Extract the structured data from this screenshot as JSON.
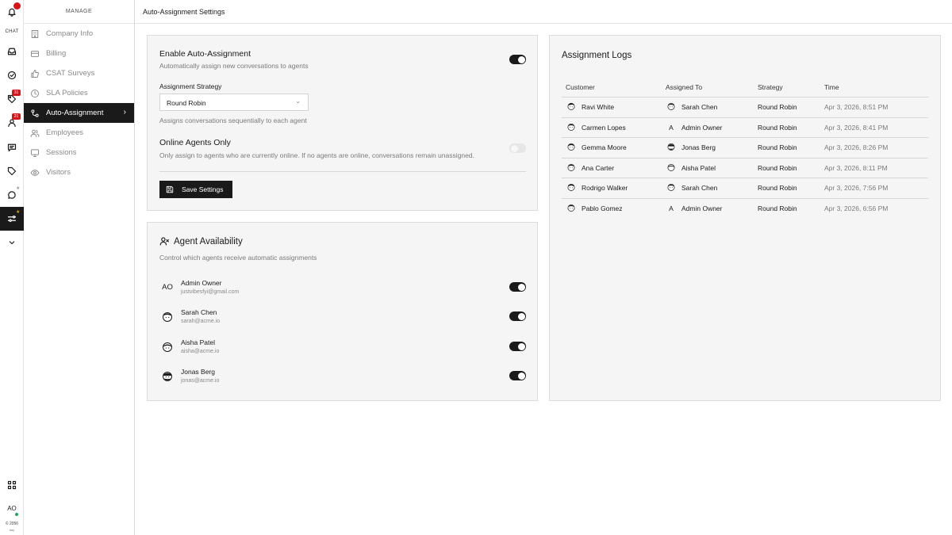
{
  "rail": {
    "chat_label": "CHAT",
    "badge_assigned": "31",
    "badge_contacts": "21",
    "user_initials": "AO",
    "copyright": "© 2056",
    "copyright_sub": "day"
  },
  "menu": {
    "title": "MANAGE",
    "items": [
      {
        "label": "Company Info",
        "icon": "building-icon"
      },
      {
        "label": "Billing",
        "icon": "credit-card-icon"
      },
      {
        "label": "CSAT Surveys",
        "icon": "thumbs-up-icon"
      },
      {
        "label": "SLA Policies",
        "icon": "clock-icon"
      },
      {
        "label": "Auto-Assignment",
        "icon": "route-icon",
        "active": true
      },
      {
        "label": "Employees",
        "icon": "users-icon"
      },
      {
        "label": "Sessions",
        "icon": "monitor-icon"
      },
      {
        "label": "Visitors",
        "icon": "eye-icon"
      }
    ]
  },
  "header": {
    "title": "Auto-Assignment Settings"
  },
  "settings": {
    "enable_title": "Enable Auto-Assignment",
    "enable_desc": "Automatically assign new conversations to agents",
    "enable_on": true,
    "strategy_label": "Assignment Strategy",
    "strategy_value": "Round Robin",
    "strategy_help": "Assigns conversations sequentially to each agent",
    "online_title": "Online Agents Only",
    "online_desc": "Only assign to agents who are currently online. If no agents are online, conversations remain unassigned.",
    "online_on": false,
    "save_label": "Save Settings"
  },
  "agents": {
    "title": "Agent Availability",
    "subtitle": "Control which agents receive automatic assignments",
    "list": [
      {
        "initials": "AO",
        "name": "Admin Owner",
        "email": "justvibesfyi@gmail.com",
        "enabled": true
      },
      {
        "name": "Sarah Chen",
        "email": "sarah@acme.io",
        "enabled": true
      },
      {
        "name": "Aisha Patel",
        "email": "aisha@acme.io",
        "enabled": true
      },
      {
        "name": "Jonas Berg",
        "email": "jonas@acme.io",
        "enabled": true
      }
    ]
  },
  "logs": {
    "title": "Assignment Logs",
    "columns": [
      "Customer",
      "Assigned To",
      "Strategy",
      "Time"
    ],
    "rows": [
      {
        "customer": "Ravi White",
        "assigned": "Sarah Chen",
        "strategy": "Round Robin",
        "time": "Apr 3, 2026, 8:51 PM"
      },
      {
        "customer": "Carmen Lopes",
        "assigned": "Admin Owner",
        "assigned_initial": "A",
        "strategy": "Round Robin",
        "time": "Apr 3, 2026, 8:41 PM"
      },
      {
        "customer": "Gemma Moore",
        "assigned": "Jonas Berg",
        "strategy": "Round Robin",
        "time": "Apr 3, 2026, 8:26 PM"
      },
      {
        "customer": "Ana Carter",
        "assigned": "Aisha Patel",
        "strategy": "Round Robin",
        "time": "Apr 3, 2026, 8:11 PM"
      },
      {
        "customer": "Rodrigo Walker",
        "assigned": "Sarah Chen",
        "strategy": "Round Robin",
        "time": "Apr 3, 2026, 7:56 PM"
      },
      {
        "customer": "Pablo Gomez",
        "assigned": "Admin Owner",
        "assigned_initial": "A",
        "strategy": "Round Robin",
        "time": "Apr 3, 2026, 6:56 PM"
      }
    ]
  }
}
